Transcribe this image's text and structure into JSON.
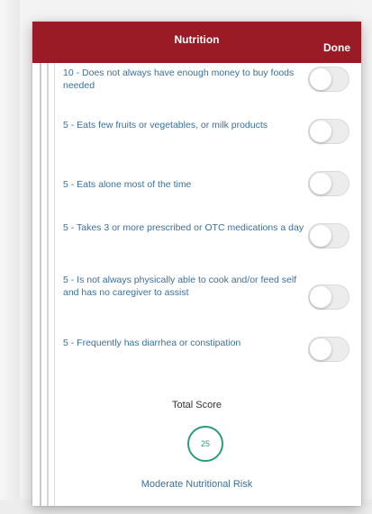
{
  "header": {
    "title": "Nutrition",
    "done_label": "Done"
  },
  "items": [
    {
      "label": "10 - Does not always have enough money to buy foods needed",
      "enabled": false
    },
    {
      "label": "5 - Eats few fruits or vegetables, or milk products",
      "enabled": false
    },
    {
      "label": "5 - Eats alone most of the time",
      "enabled": false
    },
    {
      "label": "5 - Takes 3 or more prescribed or OTC medications a day",
      "enabled": false
    },
    {
      "label": "5 - Is not always physically able to cook and/or feed self and has no caregiver to assist",
      "enabled": false
    },
    {
      "label": "5 - Frequently has diarrhea or constipation",
      "enabled": false
    }
  ],
  "summary": {
    "total_label": "Total Score",
    "score": "25",
    "risk_label": "Moderate Nutritional Risk"
  },
  "colors": {
    "header_bg": "#9a1b26",
    "label_text": "#3b6f9a",
    "score_ring": "#2e9b78"
  },
  "icons": {
    "toggle": "toggle-switch-off"
  }
}
